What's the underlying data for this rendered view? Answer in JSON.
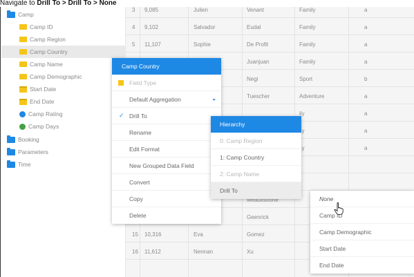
{
  "caption": {
    "prefix": "Navigate to ",
    "path": "Drill To > Drill To > None"
  },
  "sidebar": {
    "items": [
      {
        "label": "Camp",
        "icon": "folder-icon"
      },
      {
        "label": "Camp ID",
        "icon": "dimension-icon"
      },
      {
        "label": "Camp Region",
        "icon": "dimension-icon"
      },
      {
        "label": "Camp Country",
        "icon": "dimension-icon"
      },
      {
        "label": "Camp Name",
        "icon": "dimension-icon"
      },
      {
        "label": "Camp Demographic",
        "icon": "dimension-icon"
      },
      {
        "label": "Start Date",
        "icon": "date-icon"
      },
      {
        "label": "End Date",
        "icon": "date-icon"
      },
      {
        "label": "Camp Rating",
        "icon": "metric-icon"
      },
      {
        "label": "Camp Days",
        "icon": "metric-icon"
      },
      {
        "label": "Booking",
        "icon": "folder-icon"
      },
      {
        "label": "Parameters",
        "icon": "folder-icon"
      },
      {
        "label": "Time",
        "icon": "folder-icon"
      }
    ]
  },
  "colors": {
    "accent": "#1e88e5",
    "dimension": "#f5c518",
    "metric_rating": "#1e88e5",
    "metric_days": "#43a047"
  },
  "table": {
    "rows": [
      {
        "num": "3",
        "id": "9,085",
        "first": "Julien",
        "last": "Venant",
        "type": "Family",
        "flag": "a"
      },
      {
        "num": "4",
        "id": "9,102",
        "first": "Salvador",
        "last": "Eudal",
        "type": "Family",
        "flag": "a"
      },
      {
        "num": "5",
        "id": "11,107",
        "first": "Sophie",
        "last": "De Profit",
        "type": "Family",
        "flag": "a"
      },
      {
        "num": "",
        "id": "",
        "first": "",
        "last": "Juanjuan",
        "type": "Family",
        "flag": "a"
      },
      {
        "num": "",
        "id": "",
        "first": "",
        "last": "Negi",
        "type": "Sport",
        "flag": "b"
      },
      {
        "num": "",
        "id": "",
        "first": "",
        "last": "Tuescher",
        "type": "Adventure",
        "flag": "a"
      },
      {
        "num": "",
        "id": "",
        "first": "",
        "last": "",
        "type": "ily",
        "flag": "a"
      },
      {
        "num": "",
        "id": "",
        "first": "",
        "last": "",
        "type": "ily",
        "flag": "a"
      },
      {
        "num": "",
        "id": "",
        "first": "",
        "last": "",
        "type": "ily",
        "flag": "a"
      },
      {
        "num": "",
        "id": "",
        "first": "",
        "last": "",
        "type": "",
        "flag": ""
      },
      {
        "num": "",
        "id": "",
        "first": "",
        "last": "Meauxsoone",
        "type": "",
        "flag": ""
      },
      {
        "num": "",
        "id": "",
        "first": "",
        "last": "Geenrick",
        "type": "",
        "flag": ""
      },
      {
        "num": "15",
        "id": "10,316",
        "first": "Eva",
        "last": "Gomez",
        "type": "",
        "flag": ""
      },
      {
        "num": "16",
        "id": "11,612",
        "first": "Nennan",
        "last": "Xu",
        "type": "",
        "flag": ""
      }
    ]
  },
  "context_menu": {
    "title": "Camp Country",
    "items": [
      {
        "label": "Field Type",
        "disabled": true,
        "icon": "dimension-icon"
      },
      {
        "label": "Default Aggregation",
        "arrow": "▸"
      },
      {
        "label": "Drill To",
        "checked": true
      },
      {
        "label": "Rename"
      },
      {
        "label": "Edit Format"
      },
      {
        "label": "New Grouped Data Field"
      },
      {
        "label": "Convert"
      },
      {
        "label": "Copy"
      },
      {
        "label": "Delete"
      }
    ]
  },
  "drill_menu": {
    "title": "Hierarchy",
    "items": [
      {
        "label": "0: Camp Region",
        "disabled": true
      },
      {
        "label": "1: Camp Country"
      },
      {
        "label": "2: Camp Name",
        "disabled": true
      },
      {
        "label": "Drill To",
        "active": true
      }
    ]
  },
  "target_menu": {
    "items": [
      {
        "label": "None",
        "italic": true
      },
      {
        "label": "Camp ID"
      },
      {
        "label": "Camp Demographic"
      },
      {
        "label": "Start Date"
      },
      {
        "label": "End Date"
      }
    ]
  }
}
